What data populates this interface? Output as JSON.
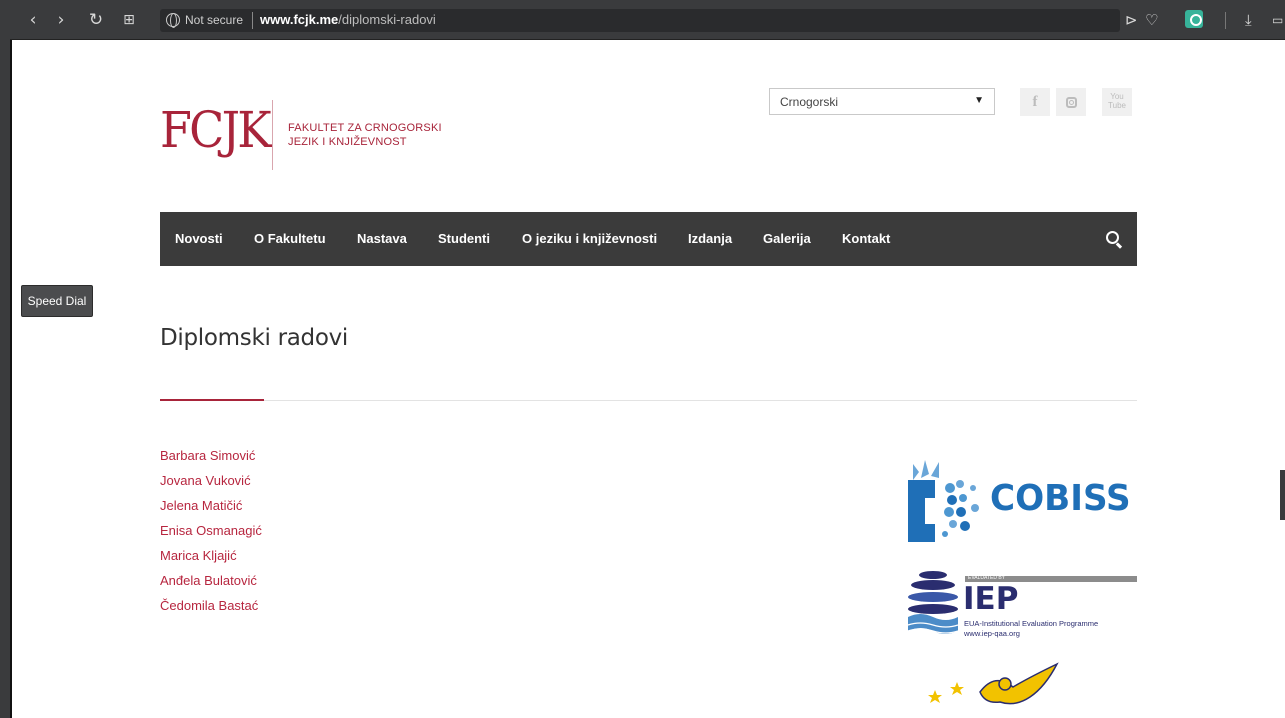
{
  "browser": {
    "security_label": "Not secure",
    "url_host": "www.fcjk.me",
    "url_path": "/diplomski-radovi"
  },
  "speed_dial": "Speed Dial",
  "header": {
    "logo_mark": "FCJK",
    "logo_line1": "FAKULTET ZA CRNOGORSKI",
    "logo_line2": "JEZIK I KNJIŽEVNOST",
    "language": "Crnogorski",
    "social": {
      "facebook": "f",
      "youtube_top": "You",
      "youtube_bottom": "Tube"
    }
  },
  "nav": {
    "items": [
      {
        "label": "Novosti"
      },
      {
        "label": "O Fakultetu"
      },
      {
        "label": "Nastava"
      },
      {
        "label": "Studenti"
      },
      {
        "label": "O jeziku i književnosti"
      },
      {
        "label": "Izdanja"
      },
      {
        "label": "Galerija"
      },
      {
        "label": "Kontakt"
      }
    ]
  },
  "page": {
    "title": "Diplomski radovi",
    "theses": [
      "Barbara Simović",
      "Jovana Vuković",
      "Jelena Matičić",
      "Enisa Osmanagić",
      "Marica Kljajić",
      "Anđela Bulatović",
      "Čedomila Bastać"
    ]
  },
  "sidebar": {
    "cobiss": "COBISS",
    "iep_band": "EVALUATED BY",
    "iep_title": "IEP",
    "iep_line1": "EUA-Institutional Evaluation Programme",
    "iep_line2": "www.iep-qaa.org"
  },
  "colors": {
    "brand": "#a8243a",
    "nav_bg": "#3b3b3b",
    "cobiss_blue": "#1f6fb7",
    "iep_navy": "#2a2d6f"
  }
}
